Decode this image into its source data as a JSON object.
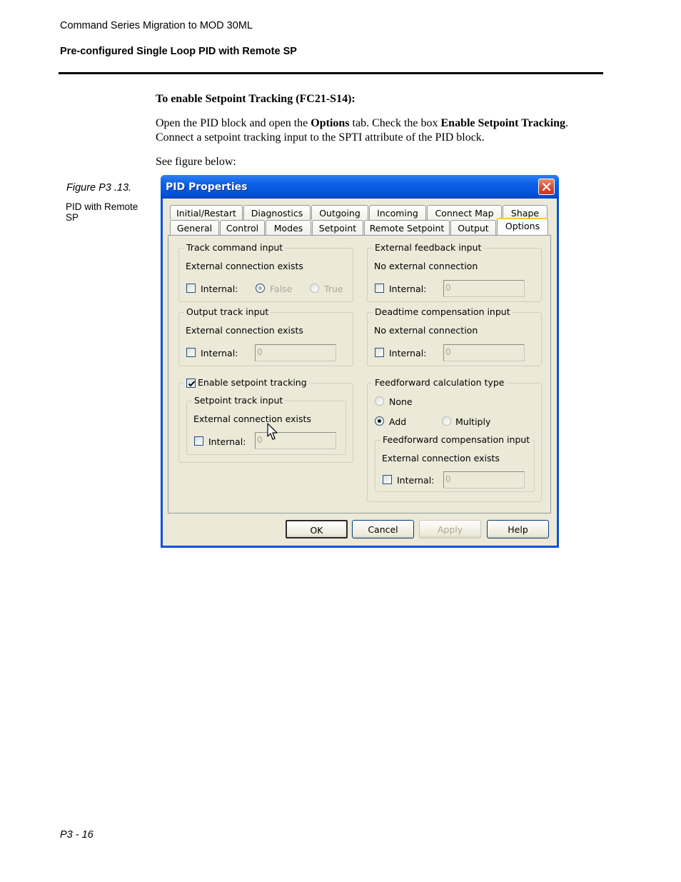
{
  "header": {
    "doc_title": "Command Series Migration to MOD 30ML",
    "section_title": "Pre-configured Single Loop PID with Remote SP"
  },
  "body": {
    "heading": "To enable Setpoint Tracking (FC21-S14):",
    "para_parts": [
      "Open the PID block and open the ",
      "Options",
      " tab. Check the box ",
      "Enable Setpoint Tracking",
      ". Connect a setpoint tracking input to the SPTI attribute of the PID block."
    ],
    "see_figure": "See figure below:"
  },
  "figure": {
    "caption": "Figure P3 .13.",
    "description": "PID with Remote SP"
  },
  "dialog": {
    "title": "PID Properties",
    "close_icon": "close-x",
    "tabs_row1": [
      "Initial/Restart",
      "Diagnostics",
      "Outgoing",
      "Incoming",
      "Connect Map",
      "Shape"
    ],
    "tabs_row2": [
      "General",
      "Control",
      "Modes",
      "Setpoint",
      "Remote Setpoint",
      "Output",
      "Options"
    ],
    "active_tab": "Options",
    "track_command": {
      "legend": "Track command input",
      "status": "External connection exists",
      "internal_label": "Internal:",
      "internal_checked": false,
      "radio_false": "False",
      "radio_true": "True",
      "selected": "False"
    },
    "external_feedback": {
      "legend": "External feedback input",
      "status": "No external connection",
      "internal_label": "Internal:",
      "internal_checked": false,
      "value": "0"
    },
    "output_track": {
      "legend": "Output track input",
      "status": "External connection exists",
      "internal_label": "Internal:",
      "internal_checked": false,
      "value": "0"
    },
    "deadtime": {
      "legend": "Deadtime compensation input",
      "status": "No external connection",
      "internal_label": "Internal:",
      "internal_checked": false,
      "value": "0"
    },
    "setpoint_tracking": {
      "enable_label": "Enable setpoint tracking",
      "enabled": true,
      "sub_legend": "Setpoint track input",
      "status": "External connection exists",
      "internal_label": "Internal:",
      "internal_checked": false,
      "value": "0"
    },
    "feedforward": {
      "legend": "Feedforward calculation type",
      "options": [
        "None",
        "Add",
        "Multiply"
      ],
      "selected": "Add",
      "comp_legend": "Feedforward compensation input",
      "comp_status": "External connection exists",
      "internal_label": "Internal:",
      "internal_checked": false,
      "value": "0"
    },
    "buttons": {
      "ok": "OK",
      "cancel": "Cancel",
      "apply": "Apply",
      "help": "Help"
    }
  },
  "footer": {
    "page_number": "P3 - 16"
  }
}
